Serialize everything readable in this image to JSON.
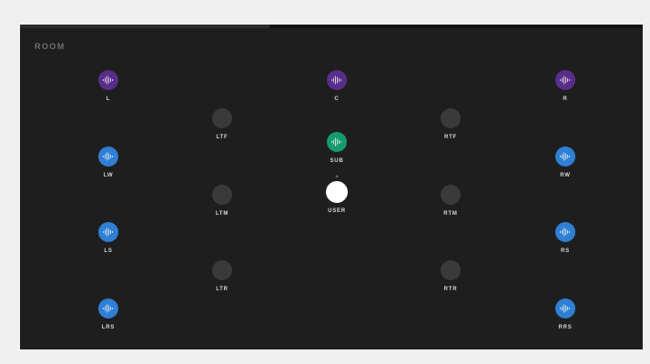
{
  "room": {
    "title": "ROOM",
    "progress_fraction": 0.4
  },
  "colors": {
    "bed": "#5a2d8a",
    "wide": "#2f7fd4",
    "sub": "#169a72",
    "height": "#3a3a3a",
    "user": "#ffffff"
  },
  "speakers": {
    "L": {
      "label": "L",
      "type": "bed",
      "icon": "waveform-icon"
    },
    "C": {
      "label": "C",
      "type": "bed",
      "icon": "waveform-icon"
    },
    "R": {
      "label": "R",
      "type": "bed",
      "icon": "waveform-icon"
    },
    "LTF": {
      "label": "LTF",
      "type": "height",
      "icon": "none"
    },
    "RTF": {
      "label": "RTF",
      "type": "height",
      "icon": "none"
    },
    "SUB": {
      "label": "SUB",
      "type": "sub",
      "icon": "waveform-icon"
    },
    "LW": {
      "label": "LW",
      "type": "wide",
      "icon": "waveform-icon"
    },
    "RW": {
      "label": "RW",
      "type": "wide",
      "icon": "waveform-icon"
    },
    "LTM": {
      "label": "LTM",
      "type": "height",
      "icon": "none"
    },
    "RTM": {
      "label": "RTM",
      "type": "height",
      "icon": "none"
    },
    "LS": {
      "label": "LS",
      "type": "wide",
      "icon": "waveform-icon"
    },
    "RS": {
      "label": "RS",
      "type": "wide",
      "icon": "waveform-icon"
    },
    "LTR": {
      "label": "LTR",
      "type": "height",
      "icon": "none"
    },
    "RTR": {
      "label": "RTR",
      "type": "height",
      "icon": "none"
    },
    "LRS": {
      "label": "LRS",
      "type": "wide",
      "icon": "waveform-icon"
    },
    "RRS": {
      "label": "RRS",
      "type": "wide",
      "icon": "waveform-icon"
    }
  },
  "user": {
    "label": "USER",
    "caret": "^"
  }
}
